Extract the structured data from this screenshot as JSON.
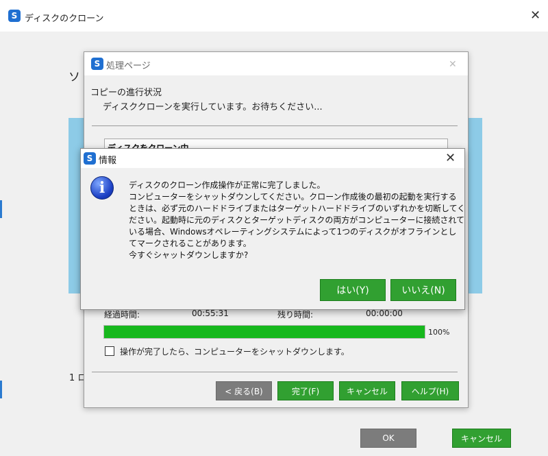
{
  "outer": {
    "title": "ディスクのクローン",
    "left_glyph": "ソ",
    "step_label": "1 ロ",
    "ok_label": "OK",
    "cancel_label": "キャンセル"
  },
  "process": {
    "title": "処理ページ",
    "heading": "コピーの進行状況",
    "subheading": "ディスククローンを実行しています。お待ちください...",
    "status_box": "ディスクをクローン中",
    "elapsed_label": "経過時間:",
    "elapsed_value": "00:55:31",
    "remaining_label": "残り時間:",
    "remaining_value": "00:00:00",
    "progress": 100,
    "progress_text": "100%",
    "shutdown_checkbox_label": "操作が完了したら、コンピューターをシャットダウンします。",
    "shutdown_checked": false,
    "back_label": "< 戻る(B)",
    "finish_label": "完了(F)",
    "cancel_label": "キャンセル",
    "help_label": "ヘルプ(H)"
  },
  "info": {
    "title": "情報",
    "lines": [
      "ディスクのクローン作成操作が正常に完了しました。",
      "コンピューターをシャットダウンしてください。クローン作成後の最初の起動を実行する",
      "ときは、必ず元のハードドライブまたはターゲットハードドライブのいずれかを切断してく",
      "ださい。起動時に元のディスクとターゲットディスクの両方がコンピューターに接続されて",
      "いる場合、Windowsオペレーティングシステムによって1つのディスクがオフラインとし",
      "てマークされることがあります。",
      "今すぐシャットダウンしますか?"
    ],
    "yes_label": "はい(Y)",
    "no_label": "いいえ(N)"
  },
  "colors": {
    "accent_green": "#31a031",
    "progress_green": "#17b81d",
    "panel_blue": "#8dcbe7"
  },
  "icons": {
    "app": "app-logo-icon",
    "info": "info-icon",
    "close": "close-icon"
  }
}
